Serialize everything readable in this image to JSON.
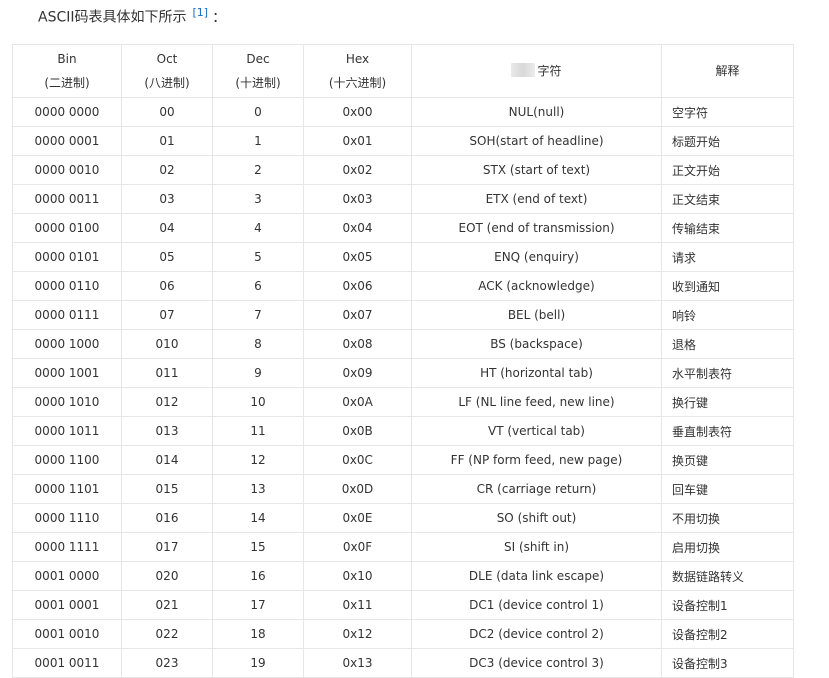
{
  "intro": {
    "text": "ASCII码表具体如下所示",
    "ref": "[1]",
    "colon": "："
  },
  "table": {
    "headers": [
      {
        "line1": "Bin",
        "line2": "(二进制)"
      },
      {
        "line1": "Oct",
        "line2": "(八进制)"
      },
      {
        "line1": "Dec",
        "line2": "(十进制)"
      },
      {
        "line1": "Hex",
        "line2": "(十六进制)"
      },
      {
        "line1": "字符",
        "line2": ""
      },
      {
        "line1": "解释",
        "line2": ""
      }
    ],
    "rows": [
      [
        "0000 0000",
        "00",
        "0",
        "0x00",
        "NUL(null)",
        "空字符"
      ],
      [
        "0000 0001",
        "01",
        "1",
        "0x01",
        "SOH(start of headline)",
        "标题开始"
      ],
      [
        "0000 0010",
        "02",
        "2",
        "0x02",
        "STX (start of text)",
        "正文开始"
      ],
      [
        "0000 0011",
        "03",
        "3",
        "0x03",
        "ETX (end of text)",
        "正文结束"
      ],
      [
        "0000 0100",
        "04",
        "4",
        "0x04",
        "EOT (end of transmission)",
        "传输结束"
      ],
      [
        "0000 0101",
        "05",
        "5",
        "0x05",
        "ENQ (enquiry)",
        "请求"
      ],
      [
        "0000 0110",
        "06",
        "6",
        "0x06",
        "ACK (acknowledge)",
        "收到通知"
      ],
      [
        "0000 0111",
        "07",
        "7",
        "0x07",
        "BEL (bell)",
        "响铃"
      ],
      [
        "0000 1000",
        "010",
        "8",
        "0x08",
        "BS (backspace)",
        "退格"
      ],
      [
        "0000 1001",
        "011",
        "9",
        "0x09",
        "HT (horizontal tab)",
        "水平制表符"
      ],
      [
        "0000 1010",
        "012",
        "10",
        "0x0A",
        "LF (NL line feed, new line)",
        "换行键"
      ],
      [
        "0000 1011",
        "013",
        "11",
        "0x0B",
        "VT (vertical tab)",
        "垂直制表符"
      ],
      [
        "0000 1100",
        "014",
        "12",
        "0x0C",
        "FF (NP form feed, new page)",
        "换页键"
      ],
      [
        "0000 1101",
        "015",
        "13",
        "0x0D",
        "CR (carriage return)",
        "回车键"
      ],
      [
        "0000 1110",
        "016",
        "14",
        "0x0E",
        "SO (shift out)",
        "不用切换"
      ],
      [
        "0000 1111",
        "017",
        "15",
        "0x0F",
        "SI (shift in)",
        "启用切换"
      ],
      [
        "0001 0000",
        "020",
        "16",
        "0x10",
        "DLE (data link escape)",
        "数据链路转义"
      ],
      [
        "0001 0001",
        "021",
        "17",
        "0x11",
        "DC1 (device control 1)",
        "设备控制1"
      ],
      [
        "0001 0010",
        "022",
        "18",
        "0x12",
        "DC2 (device control 2)",
        "设备控制2"
      ],
      [
        "0001 0011",
        "023",
        "19",
        "0x13",
        "DC3 (device control 3)",
        "设备控制3"
      ]
    ]
  }
}
